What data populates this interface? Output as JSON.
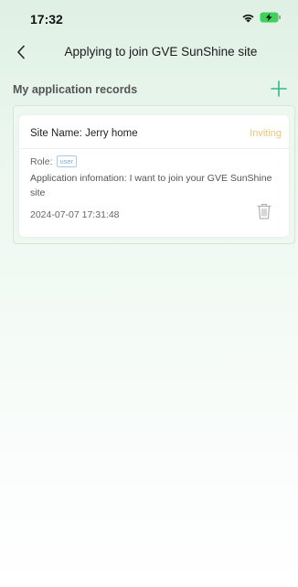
{
  "status_bar": {
    "time": "17:32"
  },
  "nav": {
    "title": "Applying to join GVE SunShine site"
  },
  "section": {
    "title": "My application records"
  },
  "records": [
    {
      "site_name": "Site Name: Jerry home",
      "status": "Inviting",
      "role_label": "Role:",
      "role": "user",
      "application_info": "Application infomation: I want to join your GVE SunShine site",
      "timestamp": "2024-07-07 17:31:48"
    }
  ],
  "colors": {
    "accent": "#33b88a",
    "status_inviting": "#e7c778",
    "role_badge": "#7da9d8"
  },
  "icons": {
    "back": "chevron-left-icon",
    "add": "plus-icon",
    "delete": "trash-icon",
    "wifi": "wifi-icon",
    "battery": "battery-charging-icon"
  }
}
